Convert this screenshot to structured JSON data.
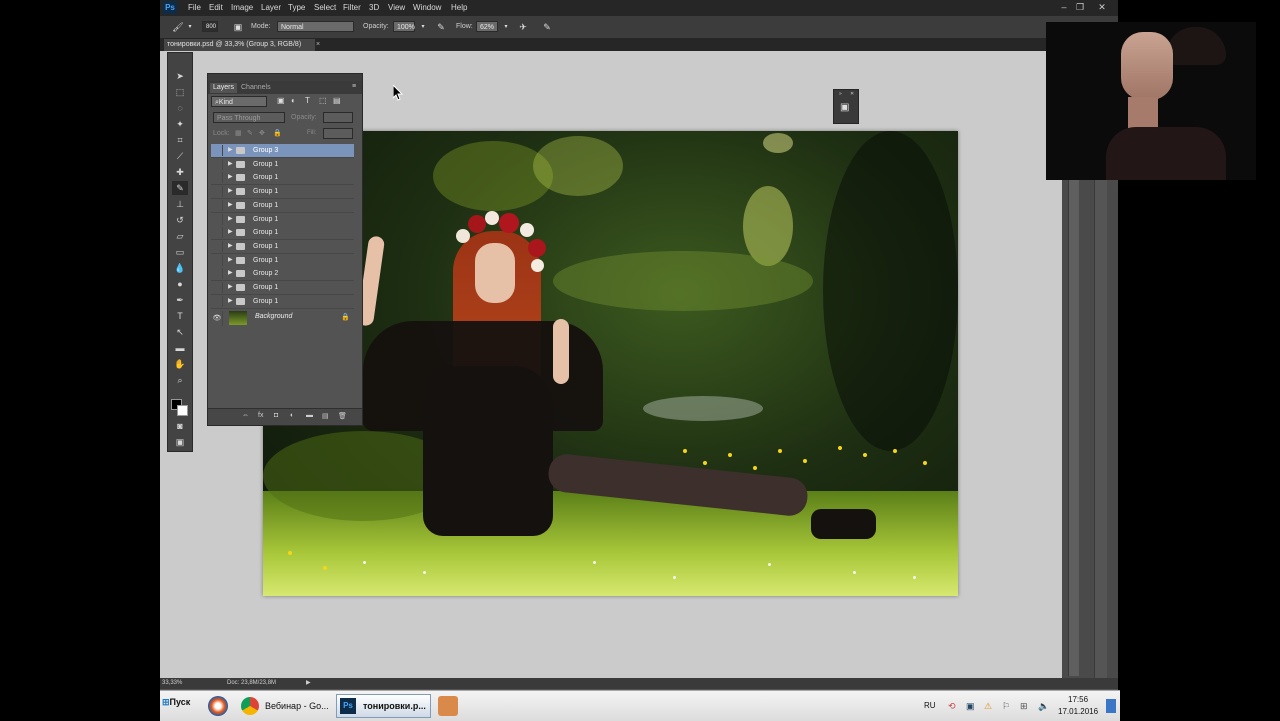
{
  "menubar": {
    "app_logo": "Ps",
    "items": [
      "File",
      "Edit",
      "Image",
      "Layer",
      "Type",
      "Select",
      "Filter",
      "3D",
      "View",
      "Window",
      "Help"
    ]
  },
  "options": {
    "brush_size": "800",
    "mode_label": "Mode:",
    "mode_value": "Normal",
    "opacity_label": "Opacity:",
    "opacity_value": "100%",
    "flow_label": "Flow:",
    "flow_value": "62%"
  },
  "document": {
    "tab_title": "тонировки.psd @ 33,3% (Group 3, RGB/8)",
    "tab_close": "×"
  },
  "layers_panel": {
    "tabs": [
      "Layers",
      "Channels"
    ],
    "filter_kind": "Kind",
    "blend_mode": "Pass Through",
    "opacity_label": "Opacity:",
    "lock_label": "Lock:",
    "fill_label": "Fill:",
    "layers": [
      {
        "name": "Group 3",
        "selected": true
      },
      {
        "name": "Group 1",
        "selected": false
      },
      {
        "name": "Group 1",
        "selected": false
      },
      {
        "name": "Group 1",
        "selected": false
      },
      {
        "name": "Group 1",
        "selected": false
      },
      {
        "name": "Group 1",
        "selected": false
      },
      {
        "name": "Group 1",
        "selected": false
      },
      {
        "name": "Group 1",
        "selected": false
      },
      {
        "name": "Group 1",
        "selected": false
      },
      {
        "name": "Group 2",
        "selected": false
      },
      {
        "name": "Group 1",
        "selected": false
      },
      {
        "name": "Group 1",
        "selected": false
      }
    ],
    "background_layer": "Background"
  },
  "status": {
    "zoom": "33,33%",
    "doc_size": "Doc: 23,8M/23,8M"
  },
  "taskbar": {
    "start_label": "Пуск",
    "chrome_task": "Вебинар - Go...",
    "ps_task": "тонировки.р...",
    "language": "RU",
    "time": "17:56",
    "date": "17.01.2016"
  }
}
